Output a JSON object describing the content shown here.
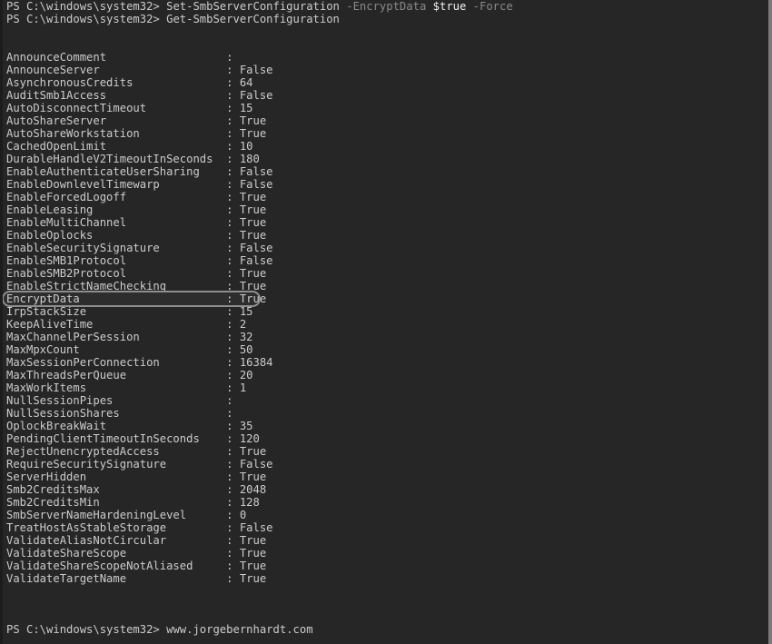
{
  "terminal": {
    "background_color": "#262626",
    "text_color": "#cccccc",
    "parameter_color": "#8a8a8a",
    "value_color": "#f2f2f2",
    "highlight_border_color": "#8e8e8e",
    "prompt": "PS C:\\windows\\system32>",
    "commands": [
      {
        "prompt": "PS C:\\windows\\system32>",
        "command": "Set-SmbServerConfiguration",
        "parameter1": "-EncryptData",
        "value1": "$true",
        "parameter2": "-Force"
      },
      {
        "prompt": "PS C:\\windows\\system32>",
        "command": "Get-SmbServerConfiguration"
      }
    ],
    "final_line": {
      "prompt": "PS C:\\windows\\system32>",
      "text": "www.jorgebernhardt.com"
    },
    "separator": ":",
    "highlighted_property": "EncryptData",
    "properties": [
      {
        "name": "AnnounceComment",
        "value": ""
      },
      {
        "name": "AnnounceServer",
        "value": "False"
      },
      {
        "name": "AsynchronousCredits",
        "value": "64"
      },
      {
        "name": "AuditSmb1Access",
        "value": "False"
      },
      {
        "name": "AutoDisconnectTimeout",
        "value": "15"
      },
      {
        "name": "AutoShareServer",
        "value": "True"
      },
      {
        "name": "AutoShareWorkstation",
        "value": "True"
      },
      {
        "name": "CachedOpenLimit",
        "value": "10"
      },
      {
        "name": "DurableHandleV2TimeoutInSeconds",
        "value": "180"
      },
      {
        "name": "EnableAuthenticateUserSharing",
        "value": "False"
      },
      {
        "name": "EnableDownlevelTimewarp",
        "value": "False"
      },
      {
        "name": "EnableForcedLogoff",
        "value": "True"
      },
      {
        "name": "EnableLeasing",
        "value": "True"
      },
      {
        "name": "EnableMultiChannel",
        "value": "True"
      },
      {
        "name": "EnableOplocks",
        "value": "True"
      },
      {
        "name": "EnableSecuritySignature",
        "value": "False"
      },
      {
        "name": "EnableSMB1Protocol",
        "value": "False"
      },
      {
        "name": "EnableSMB2Protocol",
        "value": "True"
      },
      {
        "name": "EnableStrictNameChecking",
        "value": "True"
      },
      {
        "name": "EncryptData",
        "value": "True"
      },
      {
        "name": "IrpStackSize",
        "value": "15"
      },
      {
        "name": "KeepAliveTime",
        "value": "2"
      },
      {
        "name": "MaxChannelPerSession",
        "value": "32"
      },
      {
        "name": "MaxMpxCount",
        "value": "50"
      },
      {
        "name": "MaxSessionPerConnection",
        "value": "16384"
      },
      {
        "name": "MaxThreadsPerQueue",
        "value": "20"
      },
      {
        "name": "MaxWorkItems",
        "value": "1"
      },
      {
        "name": "NullSessionPipes",
        "value": ""
      },
      {
        "name": "NullSessionShares",
        "value": ""
      },
      {
        "name": "OplockBreakWait",
        "value": "35"
      },
      {
        "name": "PendingClientTimeoutInSeconds",
        "value": "120"
      },
      {
        "name": "RejectUnencryptedAccess",
        "value": "True"
      },
      {
        "name": "RequireSecuritySignature",
        "value": "False"
      },
      {
        "name": "ServerHidden",
        "value": "True"
      },
      {
        "name": "Smb2CreditsMax",
        "value": "2048"
      },
      {
        "name": "Smb2CreditsMin",
        "value": "128"
      },
      {
        "name": "SmbServerNameHardeningLevel",
        "value": "0"
      },
      {
        "name": "TreatHostAsStableStorage",
        "value": "False"
      },
      {
        "name": "ValidateAliasNotCircular",
        "value": "True"
      },
      {
        "name": "ValidateShareScope",
        "value": "True"
      },
      {
        "name": "ValidateShareScopeNotAliased",
        "value": "True"
      },
      {
        "name": "ValidateTargetName",
        "value": "True"
      }
    ]
  }
}
